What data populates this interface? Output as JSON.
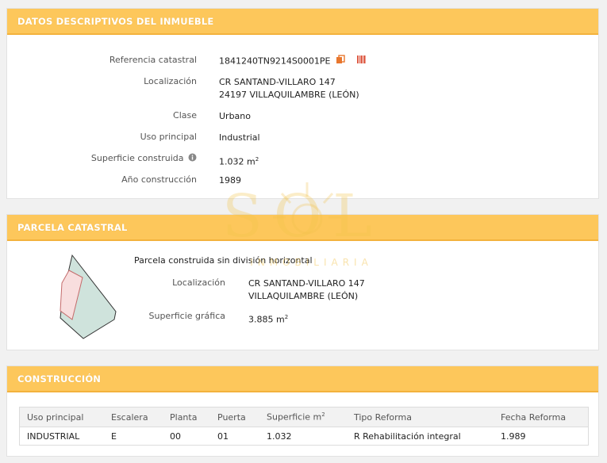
{
  "datos": {
    "header": "DATOS DESCRIPTIVOS DEL INMUEBLE",
    "referencia_label": "Referencia catastral",
    "referencia_value": "1841240TN9214S0001PE",
    "localizacion_label": "Localización",
    "localizacion_line1": "CR SANTAND-VILLARO 147",
    "localizacion_line2": "24197 VILLAQUILAMBRE (LEÓN)",
    "clase_label": "Clase",
    "clase_value": "Urbano",
    "uso_label": "Uso principal",
    "uso_value": "Industrial",
    "superficie_label": "Superficie construida",
    "superficie_value": "1.032 m",
    "superficie_exp": "2",
    "anio_label": "Año construcción",
    "anio_value": "1989"
  },
  "parcela": {
    "header": "PARCELA CATASTRAL",
    "title": "Parcela construida sin división horizontal",
    "localizacion_label": "Localización",
    "localizacion_line1": "CR SANTAND-VILLARO 147",
    "localizacion_line2": "VILLAQUILAMBRE (LEÓN)",
    "superficie_label": "Superficie gráfica",
    "superficie_value": "3.885 m",
    "superficie_exp": "2"
  },
  "construccion": {
    "header": "CONSTRUCCIÓN",
    "columns": [
      "Uso principal",
      "Escalera",
      "Planta",
      "Puerta",
      "Superficie m",
      "Tipo Reforma",
      "Fecha Reforma"
    ],
    "superficie_col_exp": "2",
    "rows": [
      [
        "INDUSTRIAL",
        "E",
        "00",
        "01",
        "1.032",
        "R Rehabilitación integral",
        "1.989"
      ]
    ]
  },
  "watermark": {
    "brand": "SOL",
    "sub": "INMOBILIARIA"
  },
  "colors": {
    "header_bg": "#fdc75b",
    "header_border": "#f3b23d",
    "icon_orange": "#e8772e",
    "icon_red": "#d9442b"
  },
  "icons": [
    "copy-icon",
    "barcode-icon",
    "info-icon"
  ]
}
